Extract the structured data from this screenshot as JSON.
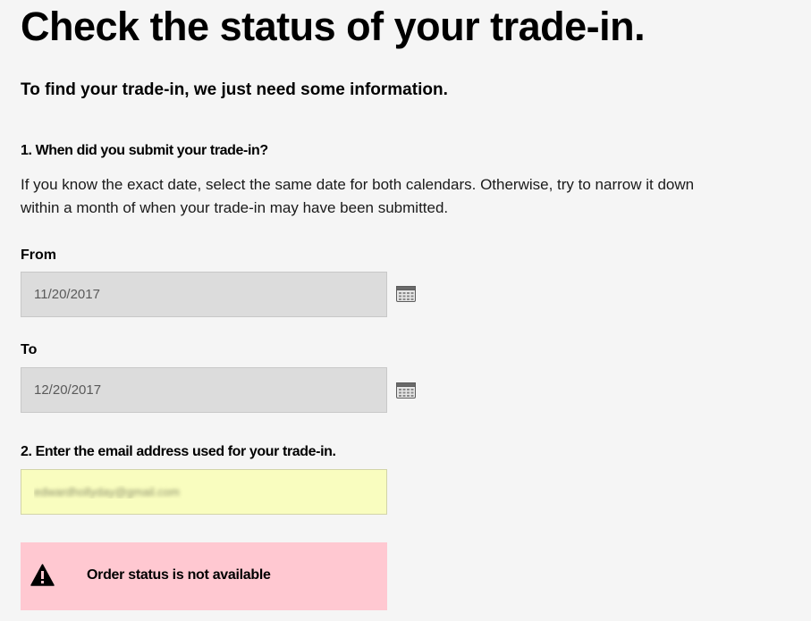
{
  "header": {
    "title": "Check the status of your trade-in.",
    "subtitle": "To find your trade-in, we just need some information."
  },
  "step1": {
    "question": "1. When did you submit your trade-in?",
    "helper": "If you know the exact date, select the same date for both calendars. Otherwise, try to narrow it down within a month of when your trade-in may have been submitted.",
    "from_label": "From",
    "from_value": "11/20/2017",
    "to_label": "To",
    "to_value": "12/20/2017",
    "calendar_icon": "calendar-icon"
  },
  "step2": {
    "question": "2. Enter the email address used for your trade-in.",
    "email_value": "edwardhollyday@gmail.com"
  },
  "alert": {
    "icon": "warning-icon",
    "message": "Order status is not available"
  },
  "colors": {
    "background": "#f5f5f5",
    "date_field": "#dcdcdc",
    "email_field": "#f9fdbf",
    "alert_bg": "#ffc8d1"
  }
}
